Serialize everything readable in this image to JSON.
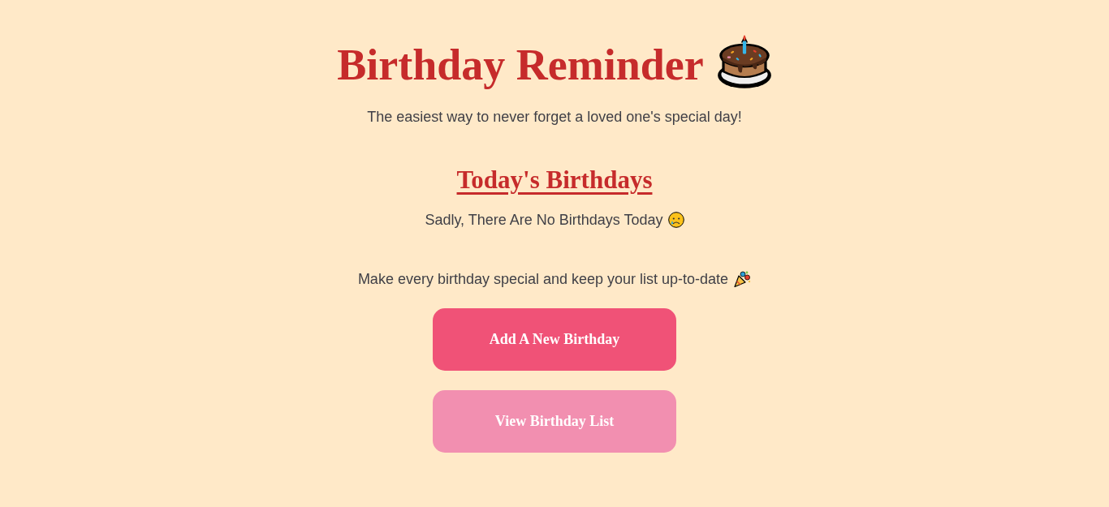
{
  "header": {
    "title": "Birthday Reminder",
    "subtitle": "The easiest way to never forget a loved one's special day!"
  },
  "today": {
    "heading": "Today's Birthdays",
    "message": "Sadly, There Are No Birthdays Today"
  },
  "footer": {
    "tagline": "Make every birthday special and keep your list up-to-date"
  },
  "buttons": [
    {
      "label": "Add A New Birthday",
      "kind": "primary"
    },
    {
      "label": "View Birthday List",
      "kind": "secondary"
    }
  ]
}
